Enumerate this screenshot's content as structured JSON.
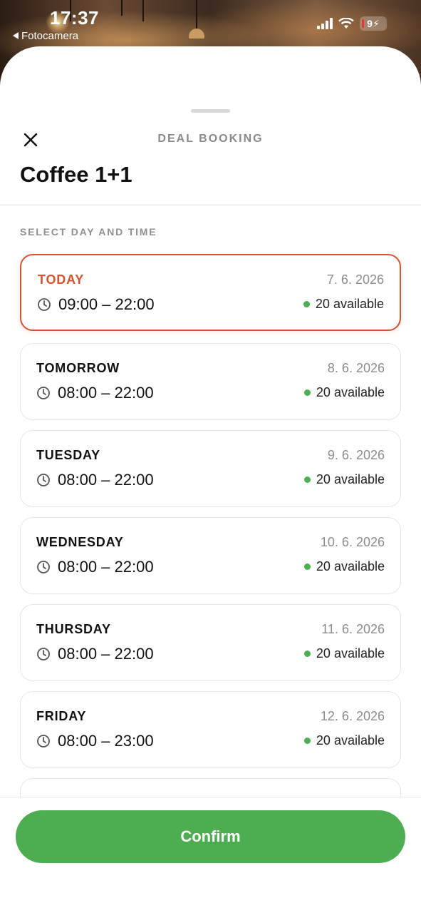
{
  "status_bar": {
    "time": "17:37",
    "back_app": "Fotocamera",
    "battery": "9"
  },
  "sheet": {
    "title": "DEAL BOOKING",
    "deal_name": "Coffee 1+1",
    "section_label": "SELECT DAY AND TIME"
  },
  "slots": [
    {
      "day": "TODAY",
      "date": "7. 6. 2026",
      "hours": "09:00 – 22:00",
      "availability": "20 available",
      "selected": true
    },
    {
      "day": "TOMORROW",
      "date": "8. 6. 2026",
      "hours": "08:00 – 22:00",
      "availability": "20 available",
      "selected": false
    },
    {
      "day": "TUESDAY",
      "date": "9. 6. 2026",
      "hours": "08:00 – 22:00",
      "availability": "20 available",
      "selected": false
    },
    {
      "day": "WEDNESDAY",
      "date": "10. 6. 2026",
      "hours": "08:00 – 22:00",
      "availability": "20 available",
      "selected": false
    },
    {
      "day": "THURSDAY",
      "date": "11. 6. 2026",
      "hours": "08:00 – 22:00",
      "availability": "20 available",
      "selected": false
    },
    {
      "day": "FRIDAY",
      "date": "12. 6. 2026",
      "hours": "08:00 – 23:00",
      "availability": "20 available",
      "selected": false
    }
  ],
  "confirm_label": "Confirm",
  "colors": {
    "accent_selected": "#d9532f",
    "confirm_green": "#4cae50",
    "available_dot": "#4caf50"
  },
  "icons": {
    "close": "close-icon",
    "clock": "clock-icon",
    "signal": "cellular-signal-icon",
    "wifi": "wifi-icon",
    "battery": "battery-icon"
  }
}
